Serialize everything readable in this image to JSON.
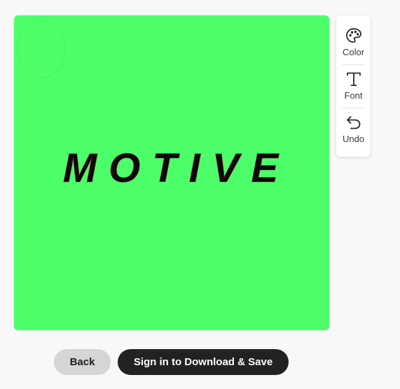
{
  "canvas": {
    "background_color": "#4cff6a",
    "logo_text": "MOTIVE",
    "logo_text_color": "#0a0a0a"
  },
  "tools": {
    "color": {
      "label": "Color",
      "icon": "palette-icon"
    },
    "font": {
      "label": "Font",
      "icon": "text-type-icon"
    },
    "undo": {
      "label": "Undo",
      "icon": "undo-arrow-icon"
    }
  },
  "actions": {
    "back_label": "Back",
    "signin_label": "Sign in to Download & Save"
  },
  "colors": {
    "page_background": "#f8f8f8",
    "primary_button": "#222222",
    "secondary_button": "#d5d5d5"
  }
}
